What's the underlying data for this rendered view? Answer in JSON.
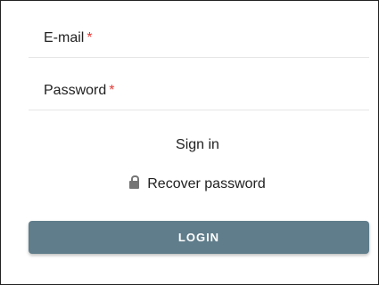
{
  "form": {
    "email": {
      "label": "E-mail",
      "required_mark": "*"
    },
    "password": {
      "label": "Password",
      "required_mark": "*"
    },
    "sign_in_link": "Sign in",
    "recover_link": {
      "icon": "lock-icon",
      "label": "Recover password"
    },
    "login_button": "LOGIN"
  },
  "colors": {
    "button": "#607d8b",
    "required": "#e53935",
    "divider": "#e6e6e6"
  }
}
